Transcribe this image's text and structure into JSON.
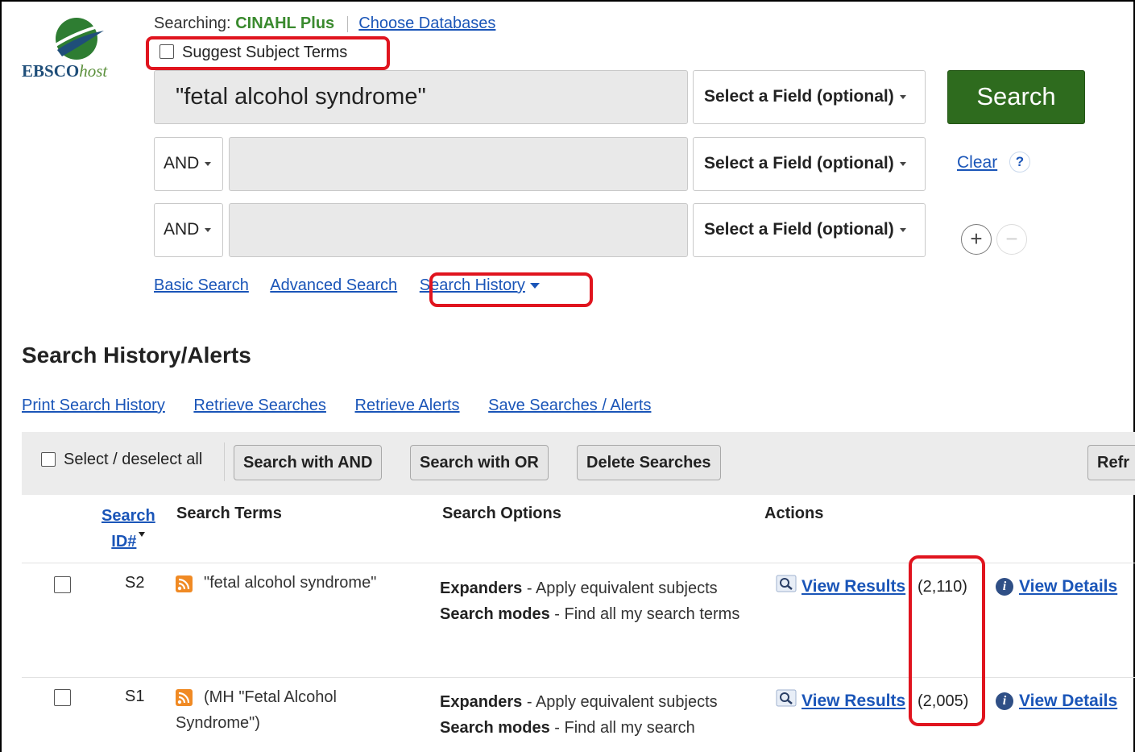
{
  "header": {
    "logo_brand": "EBSCO",
    "logo_host": "host",
    "searching_label": "Searching:",
    "database": "CINAHL Plus",
    "choose_databases": "Choose Databases",
    "suggest_subject_terms": "Suggest Subject Terms"
  },
  "search_form": {
    "rows": [
      {
        "query": "\"fetal alcohol syndrome\"",
        "field": "Select a Field (optional)"
      },
      {
        "boolean": "AND",
        "query": "",
        "field": "Select a Field (optional)"
      },
      {
        "boolean": "AND",
        "query": "",
        "field": "Select a Field (optional)"
      }
    ],
    "search_button": "Search",
    "clear_link": "Clear",
    "help_icon": "?",
    "add_row": "+",
    "remove_row": "−"
  },
  "nav_links": {
    "basic": "Basic Search",
    "advanced": "Advanced Search",
    "history": "Search History"
  },
  "history": {
    "title": "Search History/Alerts",
    "links": [
      "Print Search History",
      "Retrieve Searches",
      "Retrieve Alerts",
      "Save Searches / Alerts"
    ],
    "toolbar": {
      "select_all": "Select / deselect all",
      "search_and": "Search with AND",
      "search_or": "Search with OR",
      "delete": "Delete Searches",
      "refresh_partial": "Refr"
    },
    "columns": {
      "id_line1": "Search",
      "id_line2": "ID#",
      "terms": "Search Terms",
      "options": "Search Options",
      "actions": "Actions"
    },
    "rows": [
      {
        "id": "S2",
        "terms": "\"fetal alcohol syndrome\"",
        "expanders_label": "Expanders",
        "expanders_value": "- Apply equivalent subjects",
        "modes_label": "Search modes",
        "modes_value": "- Find all my search terms",
        "view_results": "View Results",
        "count": "(2,110)",
        "view_details": "View Details"
      },
      {
        "id": "S1",
        "terms": "(MH \"Fetal Alcohol Syndrome\")",
        "expanders_label": "Expanders",
        "expanders_value": "- Apply equivalent subjects",
        "modes_label": "Search modes",
        "modes_value": "- Find all my search",
        "view_results": "View Results",
        "count": "(2,005)",
        "view_details": "View Details"
      }
    ]
  },
  "colors": {
    "link": "#1a55b8",
    "database_green": "#3a8a2e",
    "search_button": "#2e6b1e",
    "highlight_red": "#e0141e",
    "rss_orange": "#f08a24"
  },
  "icons": [
    "ebsco-logo-icon",
    "checkbox-icon",
    "dropdown-caret-icon",
    "help-icon",
    "plus-icon",
    "minus-icon",
    "rss-icon",
    "magnifier-icon",
    "info-icon"
  ]
}
